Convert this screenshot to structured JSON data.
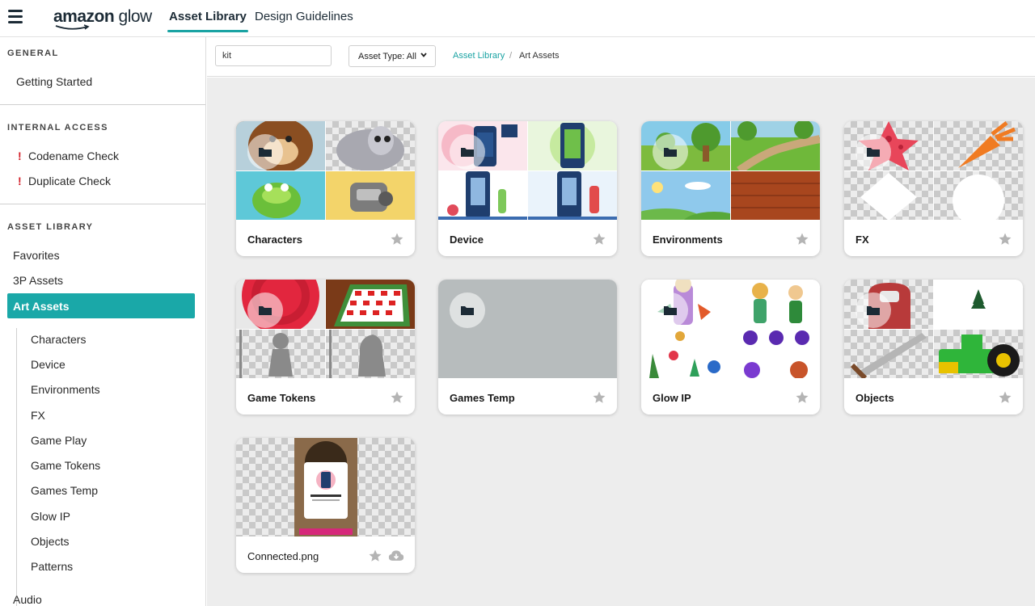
{
  "header": {
    "logo_brand": "amazon",
    "logo_product": "glow",
    "tabs": [
      {
        "label": "Asset Library",
        "active": true
      },
      {
        "label": "Design Guidelines",
        "active": false
      }
    ]
  },
  "sidebar": {
    "general": {
      "heading": "GENERAL",
      "items": [
        "Getting Started"
      ]
    },
    "internal_access": {
      "heading": "INTERNAL ACCESS",
      "items": [
        {
          "label": "Codename Check",
          "alert": "!"
        },
        {
          "label": "Duplicate Check",
          "alert": "!"
        }
      ]
    },
    "asset_library": {
      "heading": "ASSET LIBRARY",
      "items": [
        "Favorites",
        "3P Assets"
      ],
      "active_item": "Art Assets",
      "sub_items": [
        "Characters",
        "Device",
        "Environments",
        "FX",
        "Game Play",
        "Game Tokens",
        "Games Temp",
        "Glow IP",
        "Objects",
        "Patterns"
      ],
      "next_item": "Audio"
    }
  },
  "toolbar": {
    "search_value": "kit",
    "asset_type_label": "Asset Type: All",
    "breadcrumb": [
      "Asset Library",
      "/",
      "Art Assets"
    ]
  },
  "cards": [
    {
      "title": "Characters",
      "kind": "folder"
    },
    {
      "title": "Device",
      "kind": "folder"
    },
    {
      "title": "Environments",
      "kind": "folder"
    },
    {
      "title": "FX",
      "kind": "folder"
    },
    {
      "title": "Game Tokens",
      "kind": "folder"
    },
    {
      "title": "Games Temp",
      "kind": "folder"
    },
    {
      "title": "Glow IP",
      "kind": "folder"
    },
    {
      "title": "Objects",
      "kind": "folder"
    },
    {
      "title": "Connected.png",
      "kind": "file"
    }
  ],
  "colors": {
    "accent": "#1aa8a8",
    "alert": "#d3202a",
    "navy": "#1c2b36",
    "star": "#b4b4b4",
    "main_bg": "#ededed"
  },
  "icons": [
    "hamburger-icon",
    "chevron-down-icon",
    "folder-icon",
    "star-icon",
    "cloud-download-icon"
  ]
}
